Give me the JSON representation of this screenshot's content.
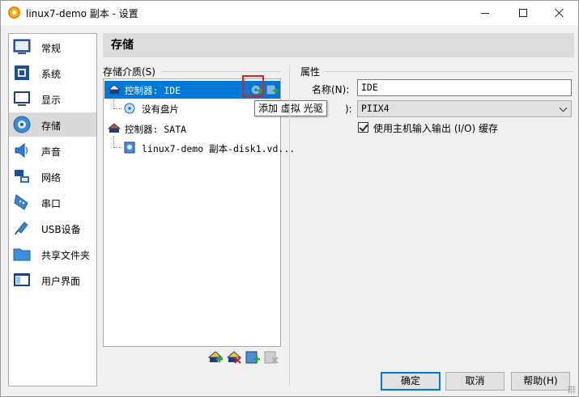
{
  "window": {
    "title": "linux7-demo 副本 - 设置",
    "buttons": {
      "minimize": "minimize",
      "maximize": "maximize",
      "close": "close"
    }
  },
  "sidebar": {
    "items": [
      {
        "label": "常规",
        "icon": "general-icon"
      },
      {
        "label": "系统",
        "icon": "system-icon"
      },
      {
        "label": "显示",
        "icon": "display-icon"
      },
      {
        "label": "存储",
        "icon": "storage-icon",
        "selected": true
      },
      {
        "label": "声音",
        "icon": "audio-icon"
      },
      {
        "label": "网络",
        "icon": "network-icon"
      },
      {
        "label": "串口",
        "icon": "serial-port-icon"
      },
      {
        "label": "USB设备",
        "icon": "usb-icon"
      },
      {
        "label": "共享文件夹",
        "icon": "shared-folder-icon"
      },
      {
        "label": "用户界面",
        "icon": "user-interface-icon"
      }
    ]
  },
  "page": {
    "title": "存储"
  },
  "storage": {
    "group_label": "存储介质(S)",
    "tree": [
      {
        "label": "控制器: IDE",
        "type": "controller",
        "selected": true
      },
      {
        "label": "没有盘片",
        "type": "optical"
      },
      {
        "label": "控制器: SATA",
        "type": "controller"
      },
      {
        "label": "linux7-demo 副本-disk1.vd...",
        "type": "hard-disk"
      }
    ],
    "tooltip": "添加 虚拟 光驱"
  },
  "properties": {
    "group_label": "属性",
    "name_label": "名称(N):",
    "name_value": "IDE",
    "type_label_tail": "):",
    "type_value": "PIIX4",
    "use_host_io_label": "使用主机输入输出 (I/O) 缓存",
    "use_host_io_checked": true
  },
  "buttons": {
    "ok": "确定",
    "cancel": "取消",
    "help": "帮助(H)"
  },
  "colors": {
    "selection": "#0078d7",
    "highlight_box": "#e02020"
  }
}
